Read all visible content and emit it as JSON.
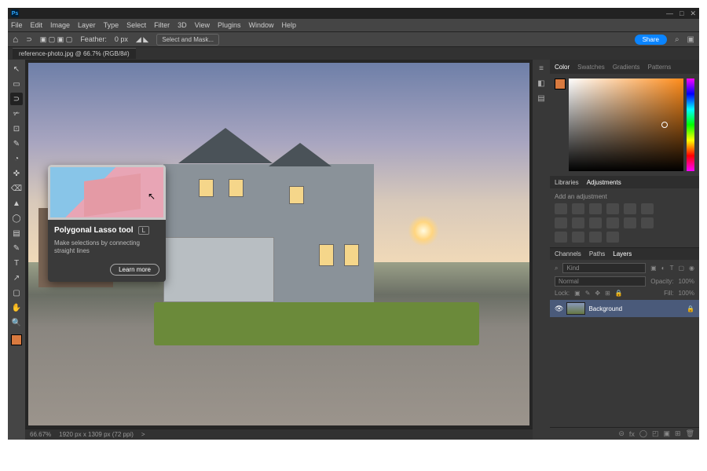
{
  "app": {
    "logo": "Ps"
  },
  "window_controls": {
    "min": "—",
    "max": "□",
    "close": "✕"
  },
  "menu": [
    "File",
    "Edit",
    "Image",
    "Layer",
    "Type",
    "Select",
    "Filter",
    "3D",
    "View",
    "Plugins",
    "Window",
    "Help"
  ],
  "options": {
    "home": "⌂",
    "feather_label": "Feather:",
    "feather_value": "0 px",
    "select_mask": "Select and Mask...",
    "share": "Share",
    "search_icon": "⌕",
    "workspace_icon": "▣"
  },
  "tab": {
    "label": "reference-photo.jpg @ 66.7% (RGB/8#)"
  },
  "tools": [
    "↖",
    "▭",
    "⊃",
    "✃",
    "⊡",
    "✎",
    "◔",
    "✜",
    "⌫",
    "▲",
    "◯",
    "▤",
    "✎",
    "T",
    "↗",
    "▢",
    "✋",
    "🔍"
  ],
  "tool_active_index": 2,
  "tooltip": {
    "title": "Polygonal Lasso tool",
    "key": "L",
    "desc": "Make selections by connecting straight lines",
    "learn": "Learn more"
  },
  "status": {
    "zoom": "66.67%",
    "docinfo": "1920 px x 1309 px (72 ppi)",
    "arrow": ">"
  },
  "midstrip": [
    "≡",
    "◧",
    "▤"
  ],
  "color_panel": {
    "tabs": [
      "Color",
      "Swatches",
      "Gradients",
      "Patterns"
    ],
    "active": 0
  },
  "adjust_panel": {
    "tabs": [
      "Libraries",
      "Adjustments"
    ],
    "active": 1,
    "hint": "Add an adjustment",
    "icons_row1": [
      "☀",
      "▤",
      "◢",
      "▨",
      "◪",
      "▽"
    ],
    "icons_row2": [
      "◫",
      "◐",
      "◧",
      "◩",
      "▦",
      "▥"
    ],
    "icons_row3": [
      "◨",
      "▩",
      "◰",
      "◱"
    ]
  },
  "layers_panel": {
    "tabs": [
      "Channels",
      "Paths",
      "Layers"
    ],
    "active": 2,
    "search_icon": "⌕",
    "kind": "Kind",
    "filters": [
      "▣",
      "◐",
      "T",
      "▢",
      "◉"
    ],
    "blend": "Normal",
    "opacity_label": "Opacity:",
    "opacity_value": "100%",
    "lock_label": "Lock:",
    "lock_icons": [
      "▣",
      "✎",
      "✥",
      "⊞",
      "🔒"
    ],
    "fill_label": "Fill:",
    "fill_value": "100%",
    "layer": {
      "name": "Background",
      "locked": "🔒"
    },
    "footer": [
      "⊝",
      "fx",
      "◯",
      "◰",
      "▣",
      "⊞",
      "🗑"
    ]
  }
}
